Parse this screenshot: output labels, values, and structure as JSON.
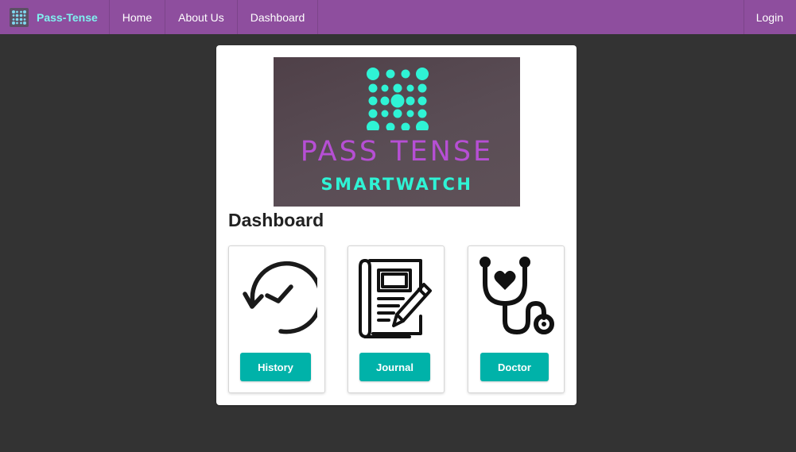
{
  "navbar": {
    "brand_name": "Pass-Tense",
    "brand_logo_icon": "dot-grid-logo-icon",
    "links": [
      {
        "label": "Home"
      },
      {
        "label": "About Us"
      },
      {
        "label": "Dashboard"
      }
    ],
    "login_label": "Login"
  },
  "hero": {
    "title": "PASS TENSE",
    "subtitle": "SMARTWATCH",
    "logo_icon": "dot-grid-logo-icon"
  },
  "dashboard": {
    "heading": "Dashboard",
    "tiles": [
      {
        "icon": "history-clock-icon",
        "button_label": "History"
      },
      {
        "icon": "journal-pen-icon",
        "button_label": "Journal"
      },
      {
        "icon": "stethoscope-heart-icon",
        "button_label": "Doctor"
      }
    ]
  },
  "colors": {
    "navbar": "#8e4e9e",
    "brand_text": "#7ff2f0",
    "page_background": "#333333",
    "card_background": "#ffffff",
    "button": "#00b2a9",
    "hero_title": "#b64fd4",
    "hero_subtitle": "#2ff3d5",
    "logo_dots": "#2ff3d5"
  }
}
